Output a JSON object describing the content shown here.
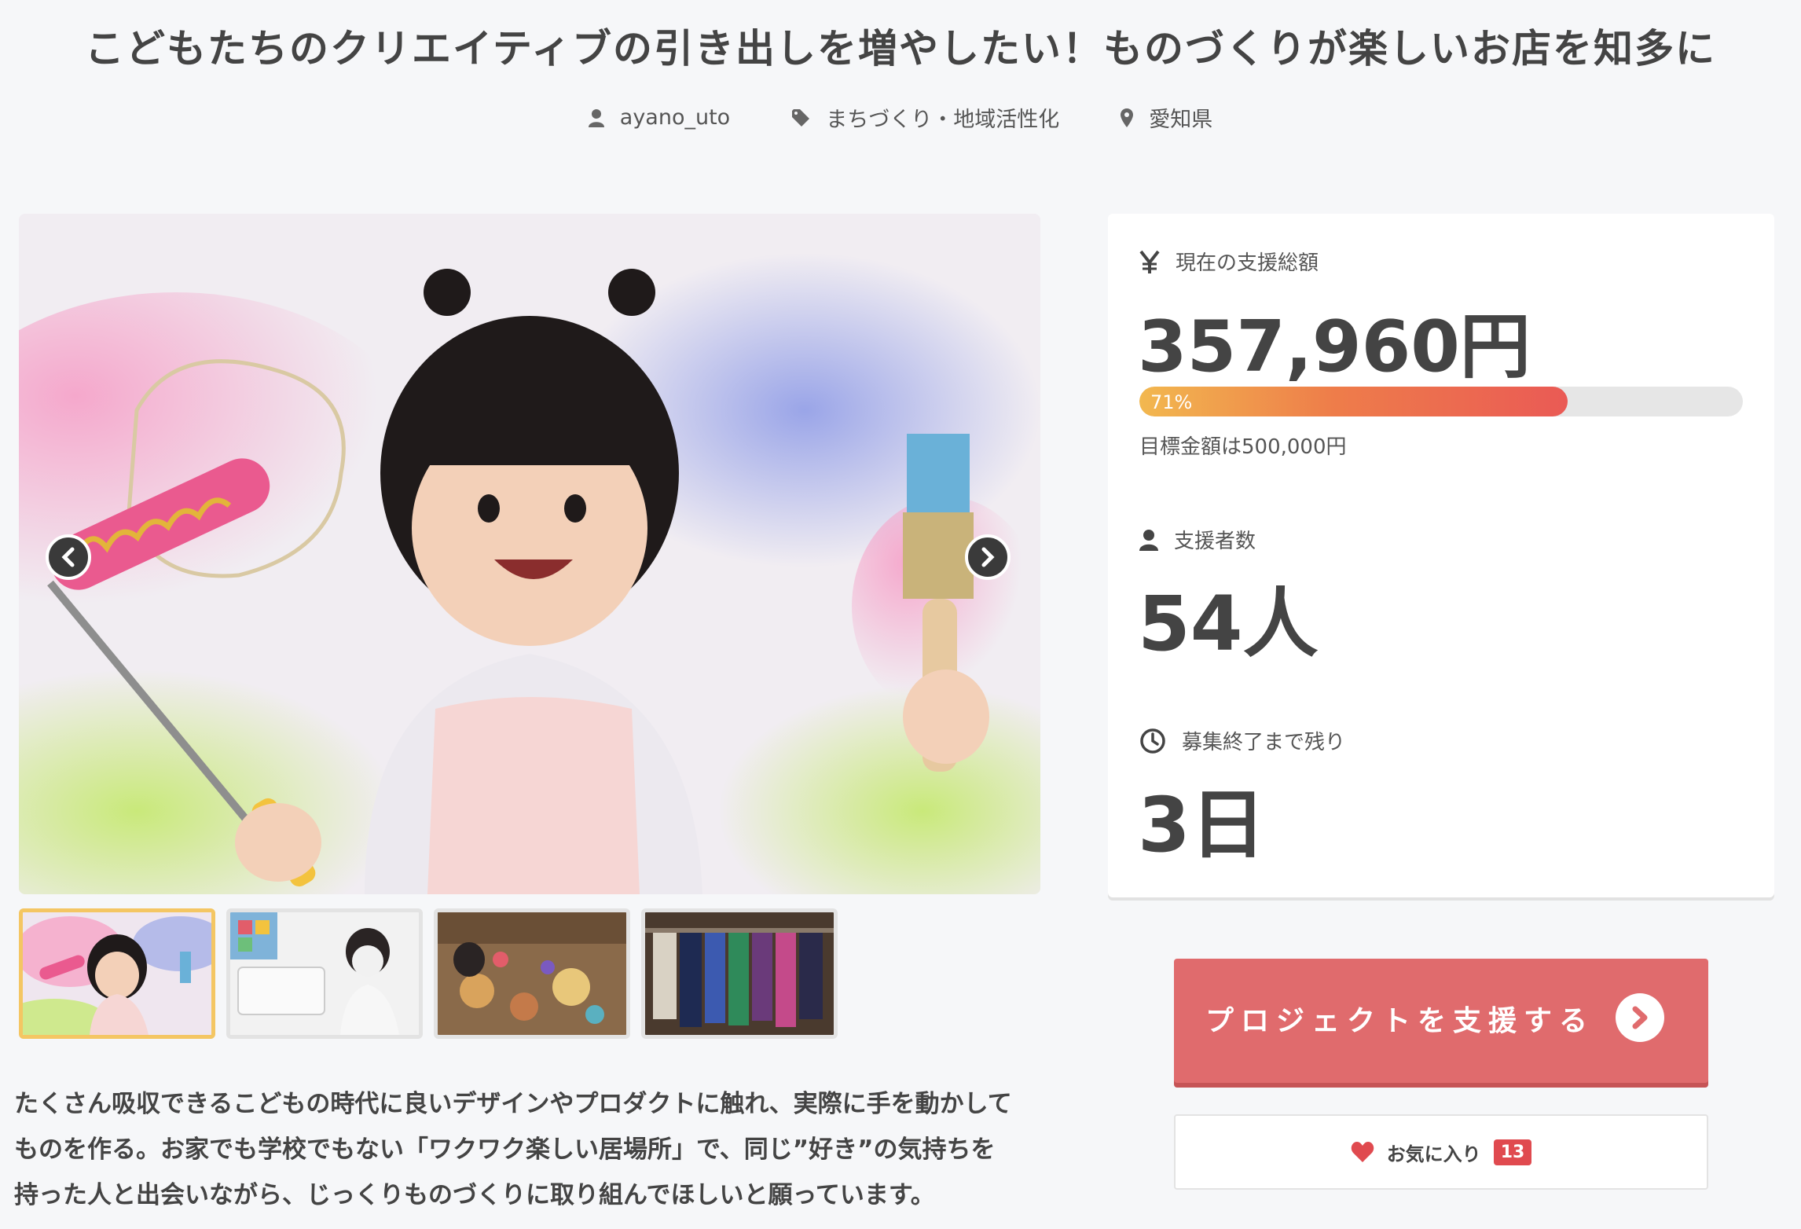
{
  "project": {
    "title": "こどもたちのクリエイティブの引き出しを増やしたい！ものづくりが楽しいお店を知多に",
    "author": "ayano_uto",
    "category": "まちづくり・地域活性化",
    "location": "愛知県"
  },
  "gallery": {
    "prev_icon": "chevron-left-icon",
    "next_icon": "chevron-right-icon",
    "active_index": 0,
    "thumbnail_count": 4
  },
  "description": "たくさん吸収できるこどもの時代に良いデザインやプロダクトに触れ、実際に手を動かして\nものを作る。お家でも学校でもない「ワクワク楽しい居場所」で、同じ”好き”の気持ちを\n持った人と出会いながら、じっくりものづくりに取り組んでほしいと願っています。",
  "stats": {
    "funding_label": "現在の支援総額",
    "funding_value": "357,960円",
    "progress_text": "71%",
    "progress_fraction": 0.71,
    "goal_text": "目標金額は500,000円",
    "backers_label": "支援者数",
    "backers_value": "54人",
    "remaining_label": "募集終了まで残り",
    "remaining_value": "3日"
  },
  "actions": {
    "support_label": "プロジェクトを支援する",
    "favorite_label": "お気に入り",
    "favorite_count": "13"
  },
  "colors": {
    "accent": "#e06b6d",
    "badge": "#e04a4f",
    "progress_start": "#f2b84f",
    "progress_end": "#ea5a55",
    "active_thumb_border": "#f4c663"
  }
}
